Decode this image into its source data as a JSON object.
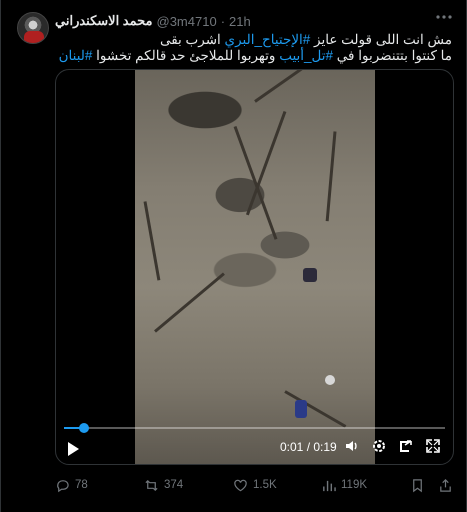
{
  "tweet": {
    "author_name": "محمد الاسكندراني",
    "handle": "@3m4710",
    "separator": "·",
    "time": "21h",
    "text_line1_prefix": "مش انت اللى قولت عايز ",
    "hashtag1": "#الإجتياح_البري",
    "text_line1_suffix": " اشرب بقى",
    "text_line2_prefix": "ما كنتوا بتتنضربوا في ",
    "hashtag2": "#تل_أبيب",
    "text_line2_middle": " وتهربوا للملاجئ حد قالكم تخشوا ",
    "hashtag3": "#لبنان"
  },
  "video": {
    "current_time": "0:01",
    "duration": "0:19",
    "time_separator": " / ",
    "progress_fraction": 0.052
  },
  "icons": {
    "more": "more-icon",
    "play": "play-icon",
    "volume": "volume-icon",
    "settings": "settings-icon",
    "pip": "pip-icon",
    "fullscreen": "fullscreen-icon"
  },
  "actions": {
    "replies": "78",
    "reposts": "374",
    "likes": "1.5K",
    "views": "119K"
  },
  "colors": {
    "accent": "#1d9bf0",
    "muted": "#71767b",
    "text": "#e7e9ea",
    "background": "#000000"
  }
}
